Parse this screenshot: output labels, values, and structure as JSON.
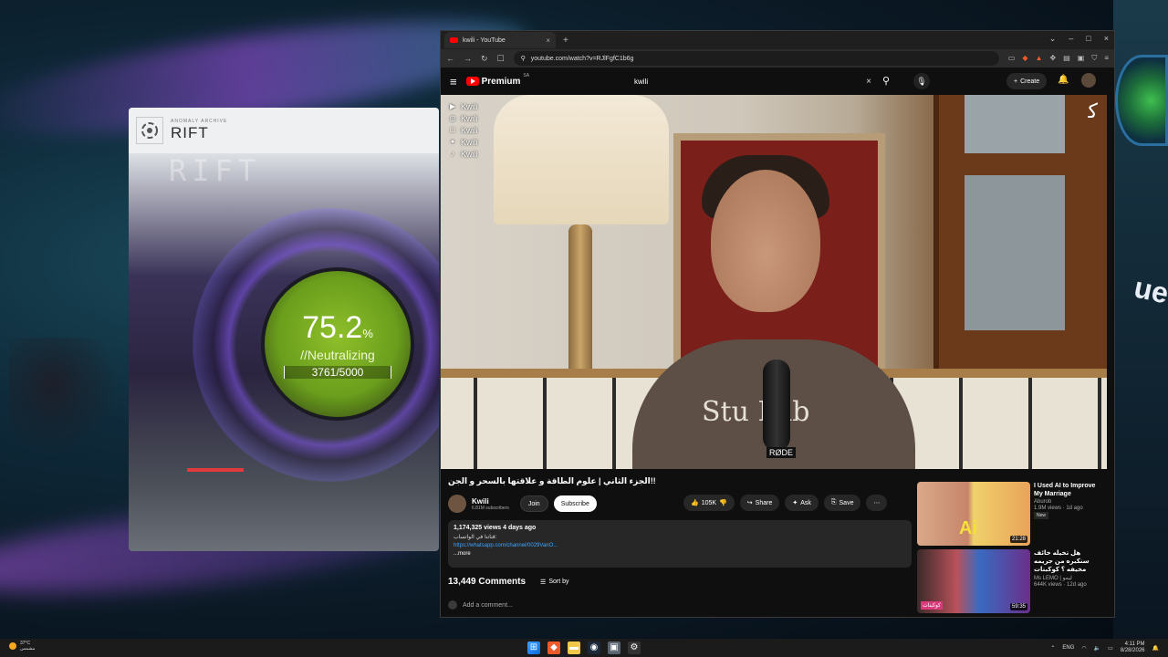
{
  "desktop": {
    "right_text": "ue"
  },
  "rift": {
    "subheader": "ANOMALY ARCHIVE",
    "title": "RIFT",
    "ghost_text": "RIFT",
    "percent": "75.2",
    "percent_unit": "%",
    "status": "//Neutralizing",
    "count": "3761/5000",
    "progress": 0.7522
  },
  "browser": {
    "tab_title": "kwili - YouTube",
    "tab_close": "×",
    "new_tab": "+",
    "win_min": "–",
    "win_max": "□",
    "win_close": "×",
    "url": "youtube.com/watch?v=RJlFgfC1b6g",
    "colors": {
      "accent": "#ff0000",
      "link": "#3ea6ff"
    }
  },
  "youtube": {
    "brand": "Premium",
    "region": "SA",
    "search_value": "kwili",
    "create_label": "Create",
    "socials": [
      {
        "icon": "youtube-icon",
        "label": "Kwili"
      },
      {
        "icon": "instagram-icon",
        "label": "Kwili"
      },
      {
        "icon": "snapchat-icon",
        "label": "Kwili"
      },
      {
        "icon": "twitter-icon",
        "label": "Kwili"
      },
      {
        "icon": "tiktok-icon",
        "label": "Kwili"
      }
    ],
    "shirt_text": "Stu  Lab",
    "mic_brand": "RØDE",
    "video_title": "الجزء الثاني | علوم الطاقة و علاقتها بالسحر و الجن!!",
    "channel": {
      "name": "Kwili",
      "subscribers": "6.81M subscribers",
      "join_label": "Join",
      "subscribe_label": "Subscribe"
    },
    "actions": {
      "likes": "105K",
      "share": "Share",
      "ask": "Ask",
      "save": "Save"
    },
    "description": {
      "stats": "1,174,325 views  4 days ago",
      "line1": "قناتنا في الواتساب:",
      "link": "https://whatsapp.com/channel/0029VanO...",
      "more": "...more"
    },
    "comments": {
      "count": "13,449 Comments",
      "sort_label": "Sort by",
      "add_placeholder": "Add a comment..."
    },
    "recommendations": [
      {
        "title": "I Used AI to Improve My Marriage",
        "channel": "Aburob",
        "meta": "1.9M views · 1d ago",
        "badge": "New",
        "duration": "21:28",
        "thumb_text": "Ai"
      },
      {
        "title": "هل تخيله خائف سنكبره من جريمه مخيفه ؟ كوكبنات",
        "channel": "Ms LEMO | ليمو",
        "meta": "644K views · 12d ago",
        "badge": "",
        "duration": "59:35",
        "thumb_text": "كوكبنات"
      }
    ]
  },
  "taskbar": {
    "weather_temp": "37°C",
    "weather_desc": "مشمس",
    "lang": "ENG",
    "time": "4:11 PM",
    "date": "8/28/2026"
  }
}
